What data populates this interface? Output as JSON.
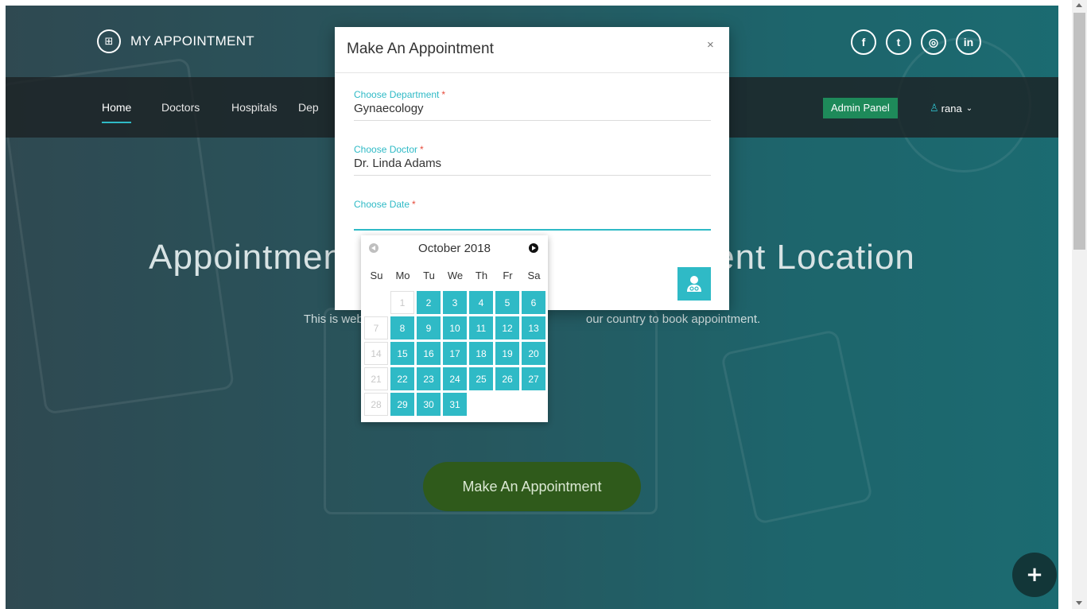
{
  "brand": {
    "name": "MY APPOINTMENT"
  },
  "socials": [
    {
      "icon": "facebook-icon",
      "glyph": "f"
    },
    {
      "icon": "twitter-icon",
      "glyph": "t"
    },
    {
      "icon": "instagram-icon",
      "glyph": "◎"
    },
    {
      "icon": "linkedin-icon",
      "glyph": "in"
    }
  ],
  "nav": {
    "items": [
      "Home",
      "Doctors",
      "Hospitals",
      "Dep"
    ],
    "active": "Home",
    "admin_button": "Admin Panel",
    "user": "rana"
  },
  "hero": {
    "title": "Appointment",
    "title_right": "tient Location",
    "subtitle_left": "This is web",
    "subtitle_right": "our country to book appointment.",
    "cta": "Make An Appointment"
  },
  "modal": {
    "title": "Make An Appointment",
    "close": "×",
    "fields": {
      "department": {
        "label": "Choose Department",
        "value": "Gynaecology"
      },
      "doctor": {
        "label": "Choose Doctor",
        "value": "Dr. Linda Adams"
      },
      "date": {
        "label": "Choose Date",
        "value": ""
      }
    },
    "required_mark": "*"
  },
  "datepicker": {
    "month_label": "October 2018",
    "weekdays": [
      "Su",
      "Mo",
      "Tu",
      "We",
      "Th",
      "Fr",
      "Sa"
    ],
    "first_weekday": 1,
    "days_in_month": 31,
    "disabled_days": [
      1,
      7,
      14,
      21,
      28
    ]
  },
  "colors": {
    "accent": "#2fbac6",
    "admin_green": "#1e8a5a",
    "cta_green": "#2f5a1b",
    "required": "#e74c3c"
  }
}
